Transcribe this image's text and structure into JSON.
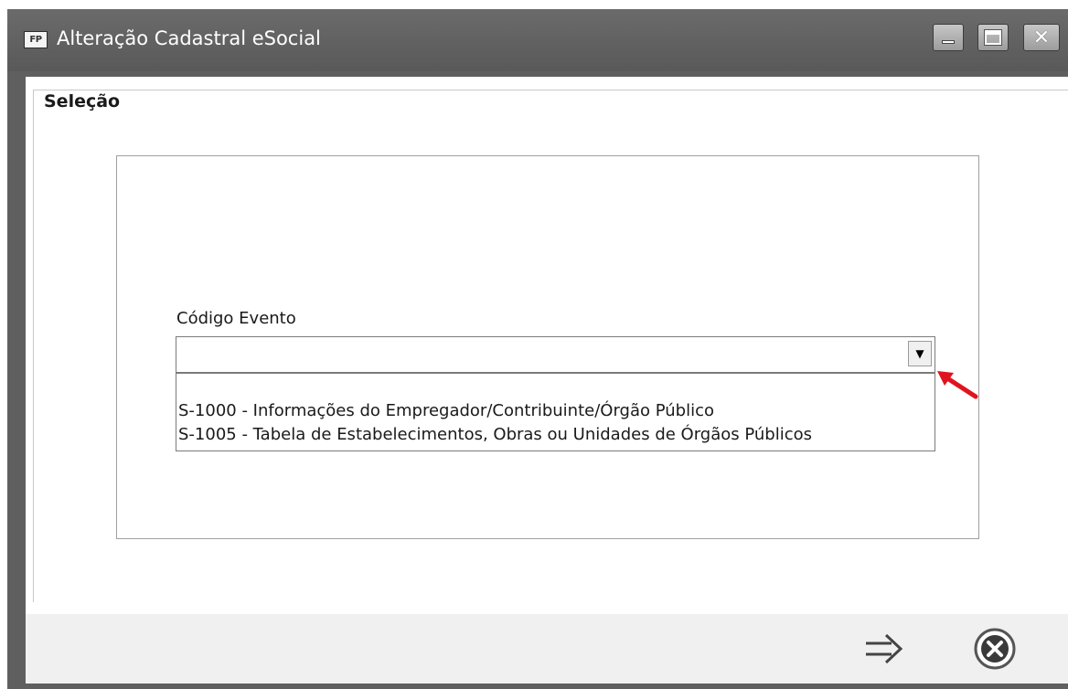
{
  "window": {
    "title": "Alteração Cadastral eSocial",
    "app_icon_text": "FP",
    "minimize_icon": "minimize-icon",
    "maximize_icon": "maximize-icon",
    "close_icon": "close-icon",
    "close_glyph": "✕"
  },
  "selection": {
    "group_title": "Seleção",
    "field_label": "Código Evento",
    "field_value": "",
    "dropdown_arrow": "▼",
    "options": [
      "S-1000 - Informações do Empregador/Contribuinte/Órgão Público",
      "S-1005 - Tabela de Estabelecimentos, Obras ou Unidades de Órgãos Públicos"
    ]
  },
  "footer": {
    "next_icon": "arrow-right-icon",
    "cancel_icon": "cancel-circle-icon"
  },
  "colors": {
    "titlebar": "#5f5f5f",
    "annotation_arrow": "#e0141e",
    "footer": "#f0f0f0"
  }
}
